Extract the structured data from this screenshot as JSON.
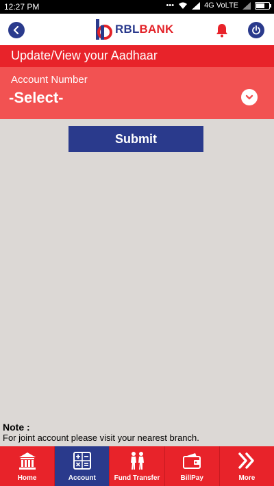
{
  "status_bar": {
    "time": "12:27 PM",
    "network": "4G VoLTE"
  },
  "header": {
    "logo_rbl": "RBL",
    "logo_bank": "BANK",
    "back_icon": "chevron-left-icon",
    "bell_icon": "bell-icon",
    "power_icon": "power-icon"
  },
  "page": {
    "title": "Update/View your Aadhaar"
  },
  "form": {
    "account_label": "Account Number",
    "account_value": "-Select-",
    "submit_label": "Submit"
  },
  "note": {
    "title": "Note :",
    "text": "For joint account please visit your nearest branch."
  },
  "bottom_nav": {
    "items": [
      {
        "label": "Home",
        "icon": "bank-building-icon",
        "active": false
      },
      {
        "label": "Account",
        "icon": "calculator-icon",
        "active": true
      },
      {
        "label": "Fund Transfer",
        "icon": "people-transfer-icon",
        "active": false
      },
      {
        "label": "BillPay",
        "icon": "wallet-icon",
        "active": false
      },
      {
        "label": "More",
        "icon": "double-chevron-right-icon",
        "active": false
      }
    ]
  },
  "colors": {
    "brand_blue": "#2a3a8c",
    "brand_red": "#e8232a",
    "panel_red": "#f25252",
    "background": "#dcd8d5"
  }
}
